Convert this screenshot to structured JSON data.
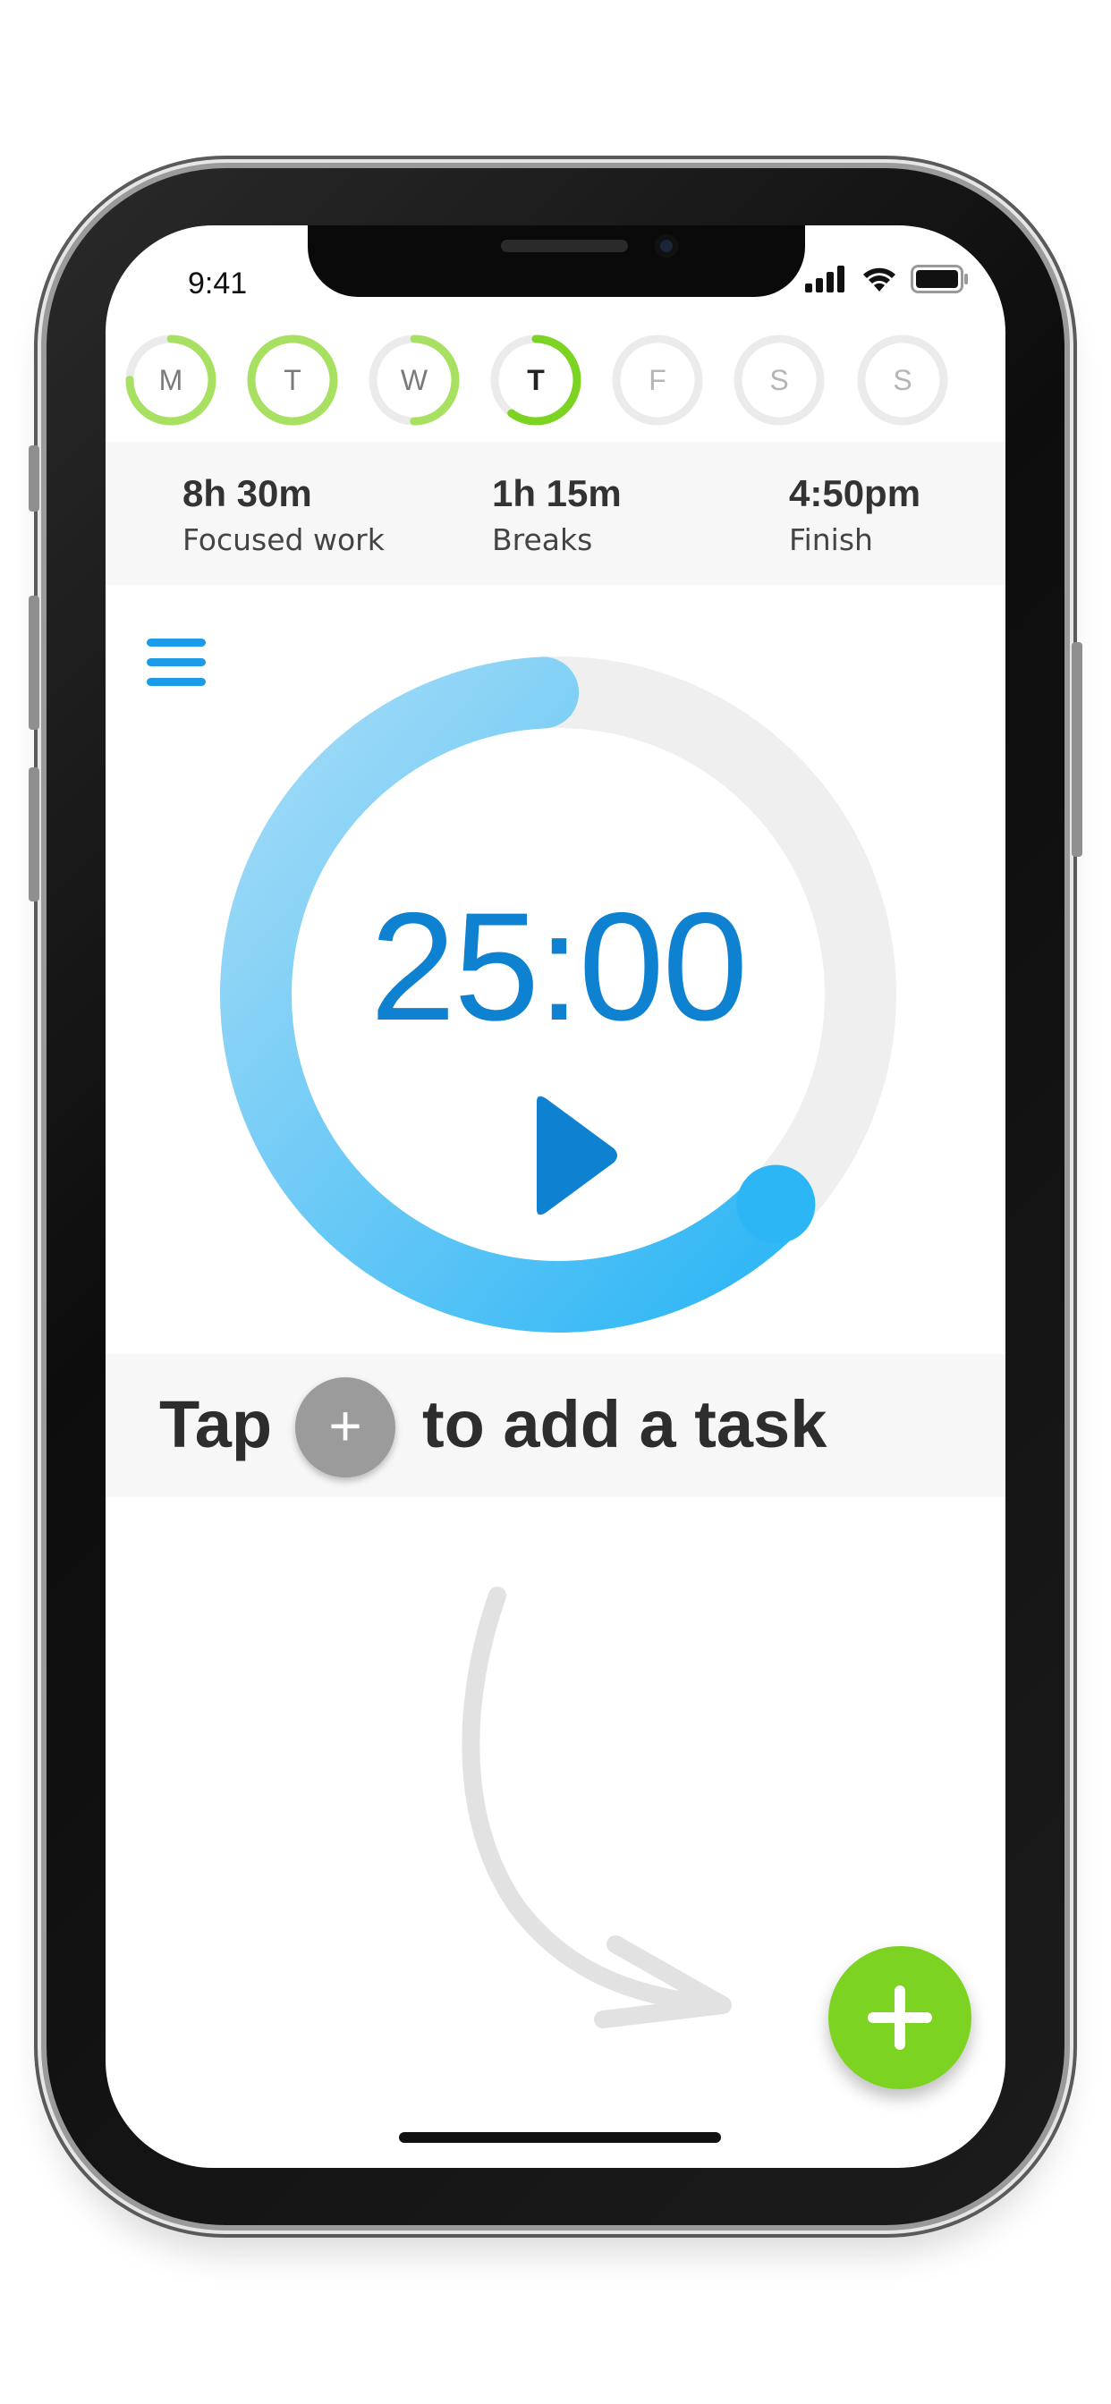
{
  "status_bar": {
    "time": "9:41",
    "icons": [
      "signal-icon",
      "wifi-icon",
      "battery-icon"
    ]
  },
  "week": {
    "days": [
      {
        "label": "M",
        "progress": 0.75,
        "state": "past"
      },
      {
        "label": "T",
        "progress": 1.0,
        "state": "past"
      },
      {
        "label": "W",
        "progress": 0.5,
        "state": "past"
      },
      {
        "label": "T",
        "progress": 0.6,
        "state": "today"
      },
      {
        "label": "F",
        "progress": 0,
        "state": "future"
      },
      {
        "label": "S",
        "progress": 0,
        "state": "future"
      },
      {
        "label": "S",
        "progress": 0,
        "state": "future"
      }
    ],
    "colors": {
      "progress": "#a8e061",
      "today": "#7dd321",
      "track": "#ebebeb"
    }
  },
  "summary": {
    "focused_value": "8h 30m",
    "focused_label": "Focused work",
    "breaks_value": "1h 15m",
    "breaks_label": "Breaks",
    "finish_value": "4:50pm",
    "finish_label": "Finish"
  },
  "timer": {
    "display": "25:00",
    "progress": 0.62,
    "colors": {
      "start": "#a6dcf7",
      "end": "#2db6f5",
      "track": "#efefef",
      "text": "#0e82d0",
      "play": "#0e82d0"
    }
  },
  "tip": {
    "before": "Tap",
    "plus": "+",
    "after": "to add a task"
  },
  "fab": {
    "icon": "plus-icon",
    "color": "#7dd321"
  },
  "menu": {
    "icon": "hamburger-menu-icon",
    "color": "#1b9be8"
  }
}
